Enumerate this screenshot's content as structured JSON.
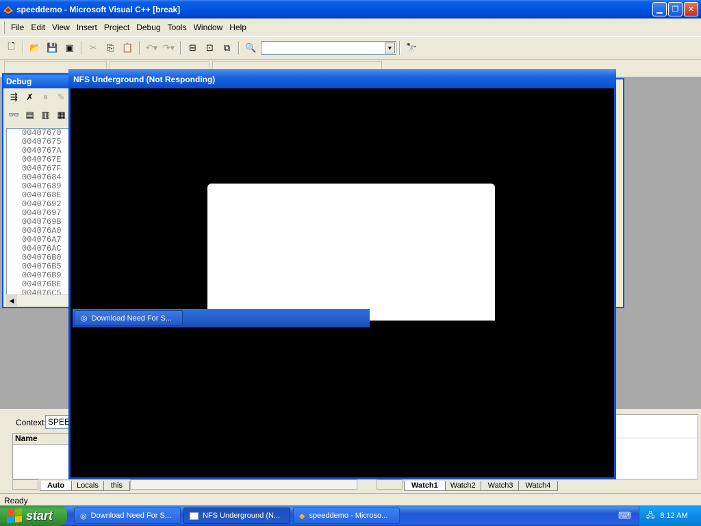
{
  "main_window": {
    "title": "speeddemo - Microsoft Visual C++ [break]",
    "controls": [
      "minimize",
      "maximize",
      "close"
    ]
  },
  "menu": {
    "items": [
      "File",
      "Edit",
      "View",
      "Insert",
      "Project",
      "Debug",
      "Tools",
      "Window",
      "Help"
    ]
  },
  "toolbar": {
    "find_combo_value": ""
  },
  "debug_window": {
    "title": "Debug",
    "addresses": [
      "00407670",
      "00407675",
      "0040767A",
      "0040767E",
      "0040767F",
      "00407684",
      "00407689",
      "0040768E",
      "00407692",
      "00407697",
      "0040769B",
      "004076A0",
      "004076A7",
      "004076AC",
      "004076B0",
      "004076B5",
      "004076B9",
      "004076BE",
      "004076C5"
    ]
  },
  "variables_panel": {
    "context_label": "Context:",
    "context_value": "SPEED",
    "column_name": "Name",
    "tabs": [
      "Auto",
      "Locals",
      "this"
    ],
    "active_tab": "Auto"
  },
  "watch_panel": {
    "tabs": [
      "Watch1",
      "Watch2",
      "Watch3",
      "Watch4"
    ],
    "active_tab": "Watch1"
  },
  "statusbar": {
    "text": "Ready"
  },
  "nfs_window": {
    "title": "NFS Underground (Not Responding)",
    "ghost_task_label": "Download Need For S..."
  },
  "taskbar": {
    "start_label": "start",
    "buttons": [
      {
        "label": "Download Need For S...",
        "icon": "browser-icon",
        "active": false
      },
      {
        "label": "NFS Underground (N...",
        "icon": "window-icon",
        "active": true
      },
      {
        "label": "speeddemo - Microso...",
        "icon": "vcpp-icon",
        "active": false
      }
    ],
    "clock": "8:12 AM"
  },
  "colors": {
    "xp_blue": "#0054e3",
    "start_green": "#3a9a3a",
    "tray_blue": "#0c8ae6"
  }
}
